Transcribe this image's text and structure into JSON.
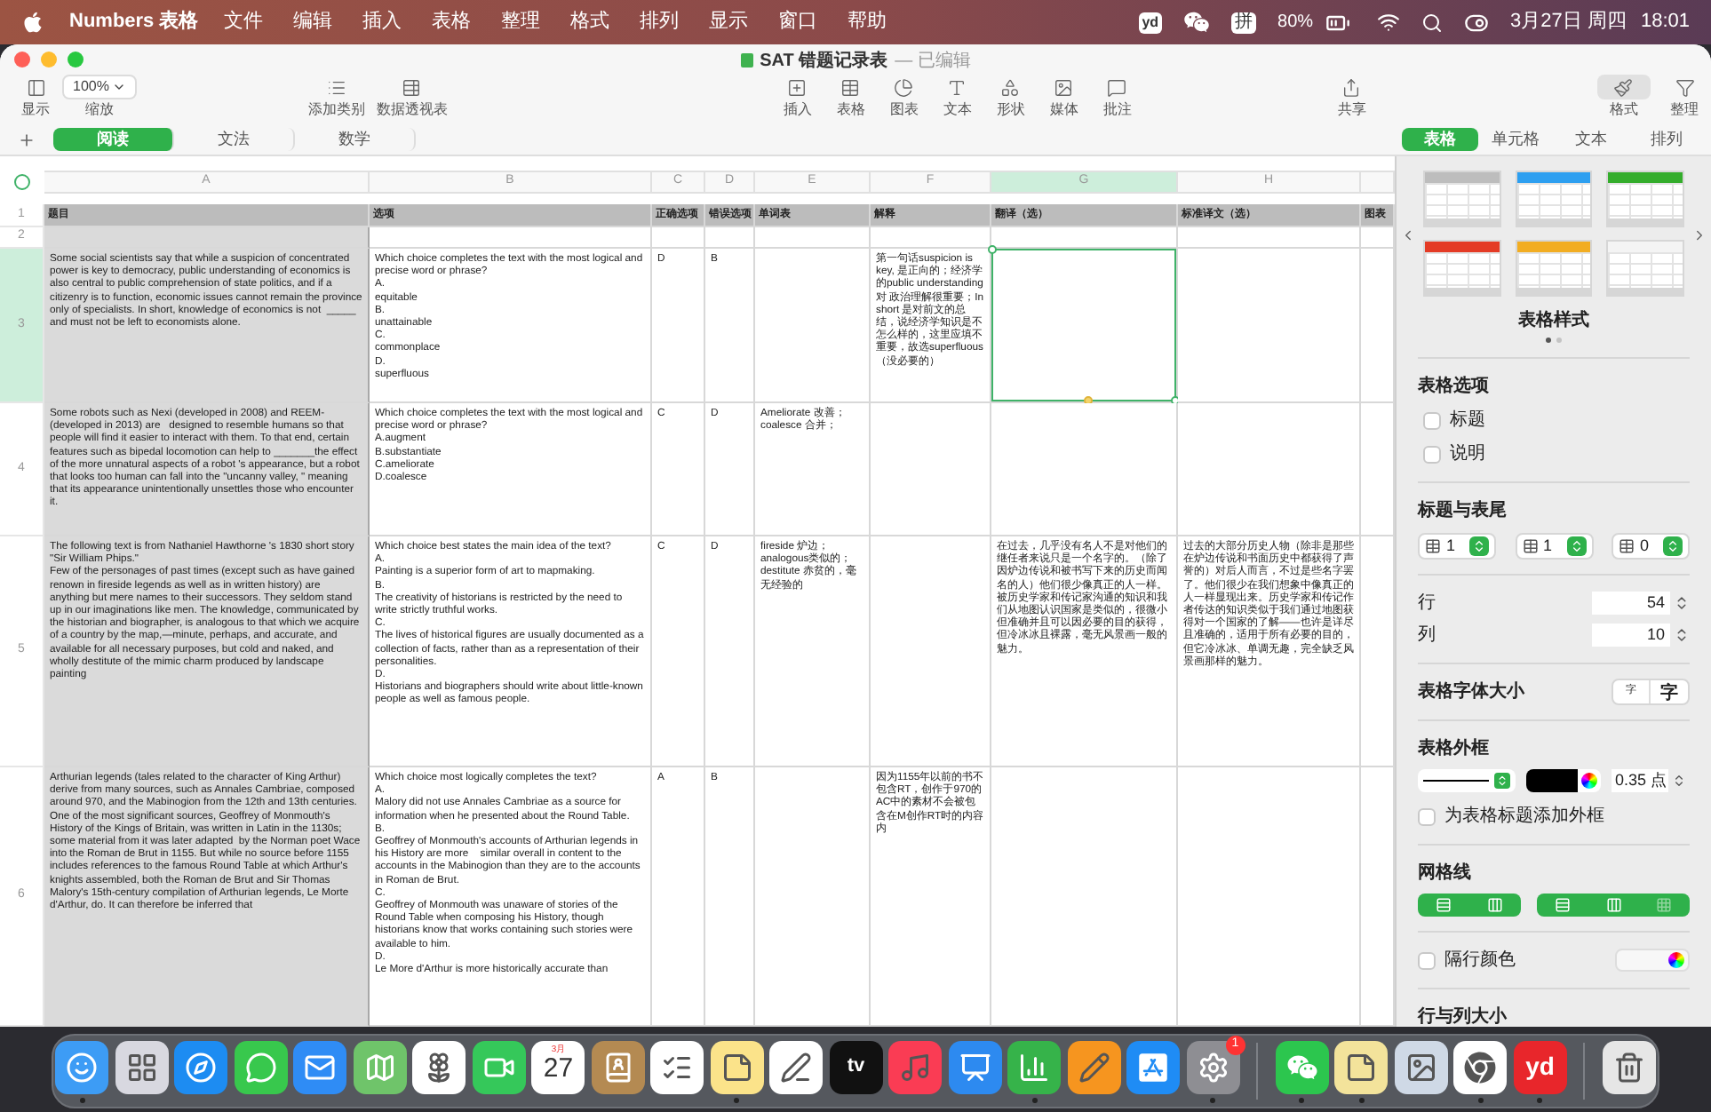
{
  "menu_bar": {
    "app_name": "Numbers 表格",
    "menus": [
      "文件",
      "编辑",
      "插入",
      "表格",
      "整理",
      "格式",
      "排列",
      "显示",
      "窗口",
      "帮助"
    ],
    "status": {
      "dictionary": "yd",
      "input_method": "拼",
      "battery": "80%",
      "date": "3月27日 周四",
      "time": "18:01"
    }
  },
  "window": {
    "title": "SAT 错题记录表",
    "status": "— 已编辑"
  },
  "toolbar": {
    "groups": [
      {
        "items": [
          {
            "kind": "button",
            "label": "显示",
            "selected": false
          },
          {
            "kind": "zoom",
            "value": "100%",
            "label": "缩放",
            "selected": false
          }
        ]
      },
      {
        "items": [
          {
            "kind": "button",
            "label": "添加类别",
            "selected": false
          },
          {
            "kind": "button",
            "label": "数据透视表",
            "selected": false
          }
        ]
      },
      {
        "items": [
          {
            "kind": "button",
            "label": "插入",
            "selected": false
          },
          {
            "kind": "button",
            "label": "表格",
            "selected": false
          },
          {
            "kind": "button",
            "label": "图表",
            "selected": false
          },
          {
            "kind": "button",
            "label": "文本",
            "selected": false
          },
          {
            "kind": "button",
            "label": "形状",
            "selected": false
          },
          {
            "kind": "button",
            "label": "媒体",
            "selected": false
          },
          {
            "kind": "button",
            "label": "批注",
            "selected": false
          }
        ]
      },
      {
        "items": [
          {
            "kind": "button",
            "label": "共享",
            "selected": false
          }
        ]
      },
      {
        "items": [
          {
            "kind": "button",
            "label": "格式",
            "selected": true
          },
          {
            "kind": "button",
            "label": "整理",
            "selected": false
          }
        ]
      }
    ]
  },
  "sheet_tabs": [
    {
      "label": "阅读",
      "selected": true
    },
    {
      "label": "文法",
      "selected": false
    },
    {
      "label": "数学",
      "selected": false
    }
  ],
  "table": {
    "columns": [
      {
        "letter": "A",
        "selected": false
      },
      {
        "letter": "B",
        "selected": false
      },
      {
        "letter": "C",
        "selected": false
      },
      {
        "letter": "D",
        "selected": false
      },
      {
        "letter": "E",
        "selected": false
      },
      {
        "letter": "F",
        "selected": false
      },
      {
        "letter": "G",
        "selected": true
      },
      {
        "letter": "H",
        "selected": false
      },
      {
        "selected": false
      }
    ],
    "rows": [
      {
        "number": "1",
        "selected": false,
        "kind": "header",
        "cells": {
          "A": "题目",
          "B": "选项",
          "C": "正确选项",
          "D": "错误选项",
          "E": "单词表",
          "F": "解释",
          "G": "翻译（选）",
          "H": "标准译文（选）",
          "I": "图表"
        }
      },
      {
        "number": "2",
        "selected": false,
        "kind": "body"
      },
      {
        "number": "3",
        "selected": true,
        "kind": "body",
        "cells": {
          "A": "Some social scientists say that while a suspicion of concentrated power is key to democracy, public understanding of economics is also central to public comprehension of state politics, and if a citizenry is to function, economic issues cannot remain the province only of specialists. In short, knowledge of economics is not  _____ and must not be left to economists alone.",
          "B": "Which choice completes the text with the most logical and precise word or phrase?\nA.\nequitable\nB.\nunattainable\nC.\ncommonplace\nD.\nsuperfluous",
          "C": "D",
          "D": "B",
          "F": "第一句话suspicion is key, 是正向的；经济学的public understanding 对 政治理解很重要；In short 是对前文的总结，说经济学知识是不怎么样的，这里应填不重要，故选superfluous（没必要的）"
        }
      },
      {
        "number": "4",
        "selected": false,
        "kind": "body",
        "cells": {
          "A": "Some robots such as Nexi (developed in 2008) and REEM-(developed in 2013) are   designed to resemble humans so that people will find it easier to interact with them. To that end, certain features such as bipedal locomotion can help to _______the effect of the more unnatural aspects of a robot 's appearance, but a robot that looks too human can fall into the \"uncanny valley, \" meaning that its appearance unintentionally unsettles those who encounter it.",
          "B": "Which choice completes the text with the most logical and precise word or phrase?\nA.augment\nB.substantiate\nC.ameliorate\nD.coalesce",
          "C": "C",
          "D": "D",
          "E": "Ameliorate 改善；\ncoalesce 合并；"
        }
      },
      {
        "number": "5",
        "selected": false,
        "kind": "body",
        "cells": {
          "A": "The following text is from Nathaniel Hawthorne 's 1830 short story \"Sir William Phips.\"\nFew of the personages of past times (except such as have gained renown in fireside legends as well as in written history) are anything but mere names to their successors. They seldom stand up in our imaginations like men. The knowledge, communicated by the historian and biographer, is analogous to that which we acquire of a country by the map,—minute, perhaps, and accurate, and available for all necessary purposes, but cold and naked, and wholly destitute of the mimic charm produced by landscape painting",
          "B": "Which choice best states the main idea of the text?\nA.\nPainting is a superior form of art to mapmaking.\nB.\nThe creativity of historians is restricted by the need to write strictly truthful works.\nC.\nThe lives of historical figures are usually documented as a collection of facts, rather than as a representation of their personalities.\nD.\nHistorians and biographers should write about little-known people as well as famous people.",
          "C": "C",
          "D": "D",
          "E": "fireside 炉边；analogous类似的；destitute 赤贫的，毫无经验的",
          "G": "在过去，几乎没有名人不是对他们的继任者来说只是一个名字的。（除了因炉边传说和被书写下来的历史而闻名的人）他们很少像真正的人一样。被历史学家和传记家沟通的知识和我们从地图认识国家是类似的，很微小但准确并且可以因必要的目的获得，但冷冰冰且裸露，毫无风景画一般的魅力。",
          "H": "过去的大部分历史人物（除非是那些在炉边传说和书面历史中都获得了声誉的）对后人而言，不过是些名字罢了。他们很少在我们想象中像真正的人一样显现出来。历史学家和传记作者传达的知识类似于我们通过地图获得对一个国家的了解——也许是详尽且准确的，适用于所有必要的目的，但它冷冰冰、单调无趣，完全缺乏风景画那样的魅力。"
        }
      },
      {
        "number": "6",
        "selected": false,
        "kind": "body",
        "cells": {
          "A": "Arthurian legends (tales related to the character of King Arthur) derive from many sources, such as Annales Cambriae, composed around 970, and the Mabinogion from the 12th and 13th centuries. One of the most significant sources, Geoffrey of Monmouth's History of the Kings of Britain, was written in Latin in the 1130s; some material from it was later adapted  by the Norman poet Wace into the Roman de Brut in 1155. But while no source before 1155 includes references to the famous Round Table at which Arthur's knights assembled, both the Roman de Brut and Sir Thomas Malory's 15th-century compilation of Arthurian legends, Le Morte d'Arthur, do. It can therefore be inferred that",
          "B": "Which choice most logically completes the text?\nA.\nMalory did not use Annales Cambriae as a source for information when he presented about the Round Table.\nB.\nGeoffrey of Monmouth's accounts of Arthurian legends in his History are more    similar overall in content to the accounts in the Mabinogion than they are to the accounts in Roman de Brut.\nC.\nGeoffrey of Monmouth was unaware of stories of the Round Table when composing his History, though historians know that works containing such stories were available to him.\nD.\nLe More d'Arthur is more historically accurate than",
          "C": "A",
          "D": "B",
          "F": "因为1155年以前的书不包含RT，创作于970的AC中的素材不会被包含在M创作RT时的内容内"
        }
      }
    ]
  },
  "inspector": {
    "tabs": [
      {
        "label": "表格",
        "selected": true
      },
      {
        "label": "单元格",
        "selected": false
      },
      {
        "label": "文本",
        "selected": false
      },
      {
        "label": "排列",
        "selected": false
      }
    ],
    "styles": [
      {
        "color": "#bdbdbd"
      },
      {
        "color": "#2d9ff0"
      },
      {
        "color": "#34ad2c"
      },
      {
        "color": "#e43b25"
      },
      {
        "color": "#f2ad22"
      },
      {
        "color": "#f4f4f4"
      }
    ],
    "styles_label": "表格样式",
    "style_pages": [
      {
        "selected": true
      },
      {
        "selected": false
      }
    ],
    "options": {
      "heading": "表格选项",
      "items": [
        {
          "label": "标题",
          "checked": false
        },
        {
          "label": "说明",
          "checked": false
        }
      ]
    },
    "headers_footers": {
      "heading": "标题与表尾",
      "values": [
        "1",
        "1",
        "0"
      ]
    },
    "rows": {
      "label": "行",
      "value": "54"
    },
    "columns": {
      "label": "列",
      "value": "10"
    },
    "font_size": {
      "label": "表格字体大小",
      "buttons": [
        "字",
        "字"
      ]
    },
    "outline": {
      "heading": "表格外框",
      "width": "0.35 点",
      "title_outline": {
        "label": "为表格标题添加外框",
        "checked": false
      }
    },
    "gridlines": {
      "heading": "网格线",
      "groups": [
        [
          {
            "on": true
          },
          {
            "on": true
          }
        ],
        [
          {
            "on": true
          },
          {
            "on": true
          },
          {
            "on": false
          }
        ]
      ]
    },
    "alternating_rows": {
      "label": "隔行颜色",
      "checked": false
    },
    "size_heading": "行与列大小"
  },
  "dock": {
    "items": [
      {
        "kind": "finder",
        "running": true
      },
      {
        "kind": "launchpad",
        "running": false
      },
      {
        "kind": "safari",
        "running": false
      },
      {
        "kind": "messages",
        "running": false
      },
      {
        "kind": "mail",
        "running": false
      },
      {
        "kind": "maps",
        "running": false
      },
      {
        "kind": "photos",
        "running": false
      },
      {
        "kind": "facetime",
        "running": false
      },
      {
        "kind": "calendar",
        "month": "3月",
        "day": "27",
        "running": false
      },
      {
        "kind": "contacts",
        "running": false
      },
      {
        "kind": "reminders",
        "running": false
      },
      {
        "kind": "notes",
        "running": true
      },
      {
        "kind": "freeform",
        "running": false
      },
      {
        "kind": "tv",
        "text": "tv",
        "running": false
      },
      {
        "kind": "music",
        "running": false
      },
      {
        "kind": "keynote",
        "running": false
      },
      {
        "kind": "numbers",
        "running": true
      },
      {
        "kind": "pages",
        "running": false
      },
      {
        "kind": "appstore",
        "running": false
      },
      {
        "kind": "settings",
        "badge": "1",
        "running": true
      },
      {
        "kind": "separator"
      },
      {
        "kind": "wechat",
        "running": true
      },
      {
        "kind": "stickies",
        "running": true
      },
      {
        "kind": "preview",
        "running": false
      },
      {
        "kind": "chrome",
        "running": true
      },
      {
        "kind": "youdao",
        "text": "yd",
        "running": true
      },
      {
        "kind": "separator"
      },
      {
        "kind": "trash",
        "running": false
      }
    ]
  }
}
